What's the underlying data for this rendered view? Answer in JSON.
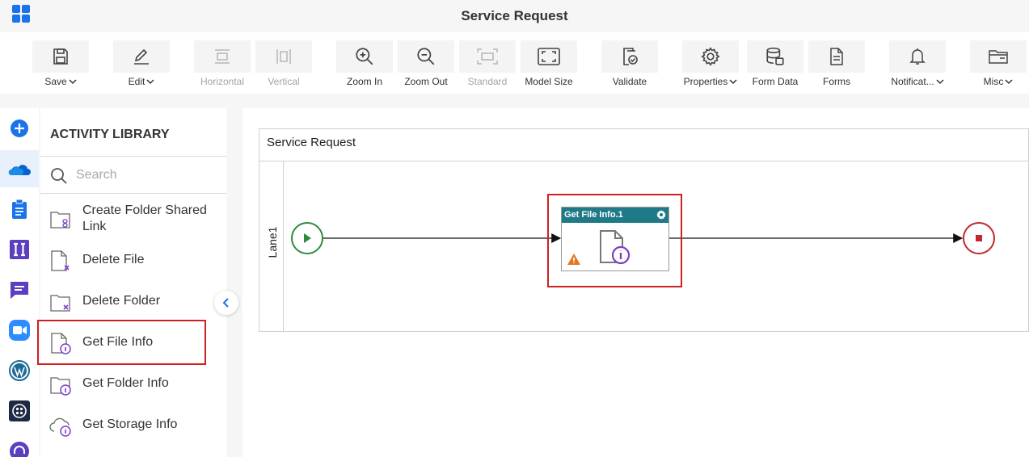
{
  "app": {
    "title": "Service Request"
  },
  "toolbar": {
    "save": "Save",
    "edit": "Edit",
    "horizontal": "Horizontal",
    "vertical": "Vertical",
    "zoom_in": "Zoom In",
    "zoom_out": "Zoom Out",
    "standard": "Standard",
    "model_size": "Model Size",
    "validate": "Validate",
    "properties": "Properties",
    "form_data": "Form Data",
    "forms": "Forms",
    "notifications": "Notificat...",
    "misc": "Misc"
  },
  "library": {
    "title": "ACTIVITY LIBRARY",
    "search_placeholder": "Search",
    "items": [
      {
        "label_line1": "Create Folder Shared",
        "label_line2": "Link"
      },
      {
        "label": "Delete File"
      },
      {
        "label": "Delete Folder"
      },
      {
        "label": "Get File Info"
      },
      {
        "label": "Get Folder Info"
      },
      {
        "label": "Get Storage Info"
      }
    ]
  },
  "canvas": {
    "pool_title": "Service Request",
    "lane_label": "Lane1",
    "task_name": "Get File Info.1"
  },
  "colors": {
    "accent": "#1a73e8",
    "task_header": "#1f7a87",
    "start_event": "#2e8b3e",
    "end_event": "#c0282d",
    "highlight": "#d11f1f",
    "warning": "#e0781f",
    "info_icon": "#7b3fc9"
  }
}
